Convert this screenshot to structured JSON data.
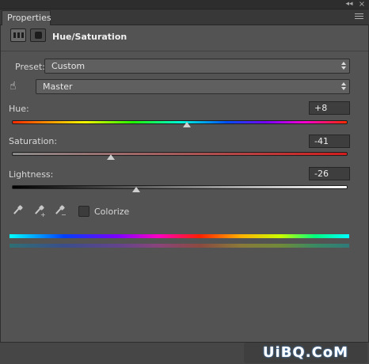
{
  "window": {
    "collapse_glyph": "◂◂",
    "close_glyph": "×"
  },
  "tab": {
    "label": "Properties"
  },
  "header": {
    "title": "Hue/Saturation",
    "icons": [
      "adjustment-layer-icon",
      "layer-mask-icon"
    ]
  },
  "preset": {
    "label": "Preset:",
    "value": "Custom"
  },
  "channel": {
    "value": "Master"
  },
  "sliders": {
    "hue": {
      "label": "Hue:",
      "value": "+8",
      "level": 8,
      "range": [
        -180,
        180
      ]
    },
    "saturation": {
      "label": "Saturation:",
      "value": "-41",
      "level": -41,
      "range": [
        -100,
        100
      ]
    },
    "lightness": {
      "label": "Lightness:",
      "value": "-26",
      "level": -26,
      "range": [
        -100,
        100
      ]
    }
  },
  "tools": {
    "pipettes": [
      "eyedropper-icon",
      "eyedropper-add-icon",
      "eyedropper-subtract-icon"
    ],
    "colorize_label": "Colorize",
    "colorize_checked": false
  },
  "colors": {
    "panel_bg": "#535353",
    "track_saturation": "#b51c1c"
  },
  "watermark": {
    "text": "UiBQ.CoM"
  }
}
